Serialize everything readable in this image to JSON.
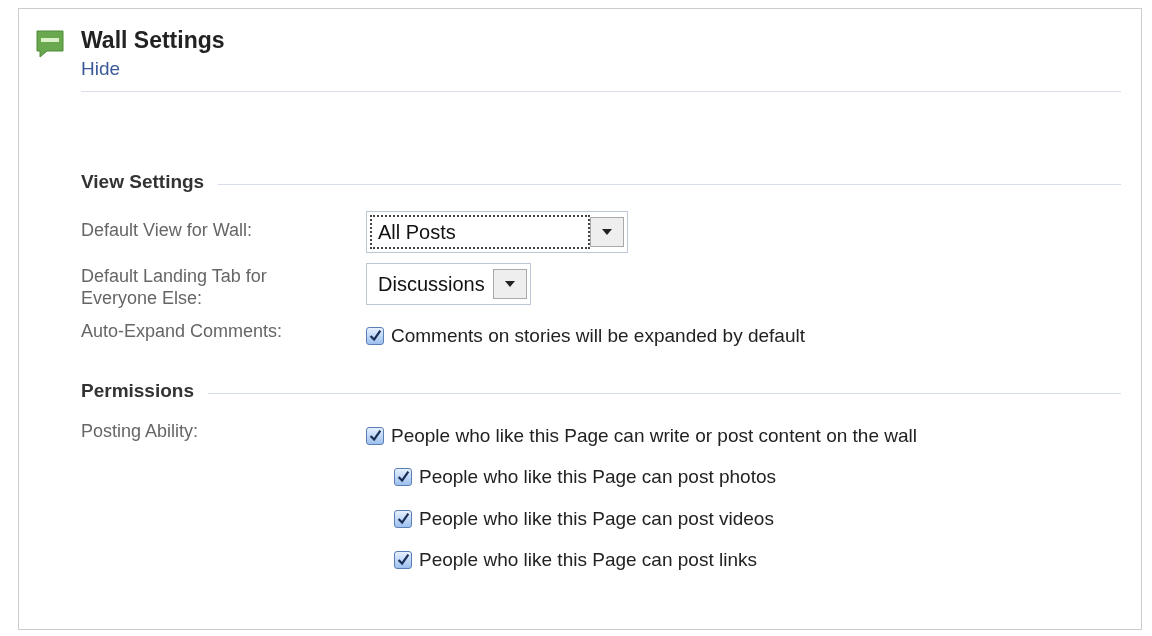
{
  "panel": {
    "title": "Wall Settings",
    "hide_link": "Hide"
  },
  "sections": [
    {
      "heading": "View Settings",
      "rows": [
        {
          "kind": "select",
          "label": "Default View for Wall:",
          "value": "All Posts",
          "focused": true
        },
        {
          "kind": "select",
          "label": "Default Landing Tab for Everyone Else:",
          "value": "Discussions",
          "focused": false
        },
        {
          "kind": "checkbox",
          "label": "Auto-Expand Comments:",
          "options": [
            {
              "label": "Comments on stories will be expanded by default",
              "checked": true
            }
          ]
        }
      ]
    },
    {
      "heading": "Permissions",
      "rows": [
        {
          "kind": "checkbox",
          "label": "Posting Ability:",
          "options": [
            {
              "label": "People who like this Page can write or post content on the wall",
              "checked": true,
              "children": [
                {
                  "label": "People who like this Page can post photos",
                  "checked": true
                },
                {
                  "label": "People who like this Page can post videos",
                  "checked": true
                },
                {
                  "label": "People who like this Page can post links",
                  "checked": true
                }
              ]
            }
          ]
        }
      ]
    }
  ]
}
